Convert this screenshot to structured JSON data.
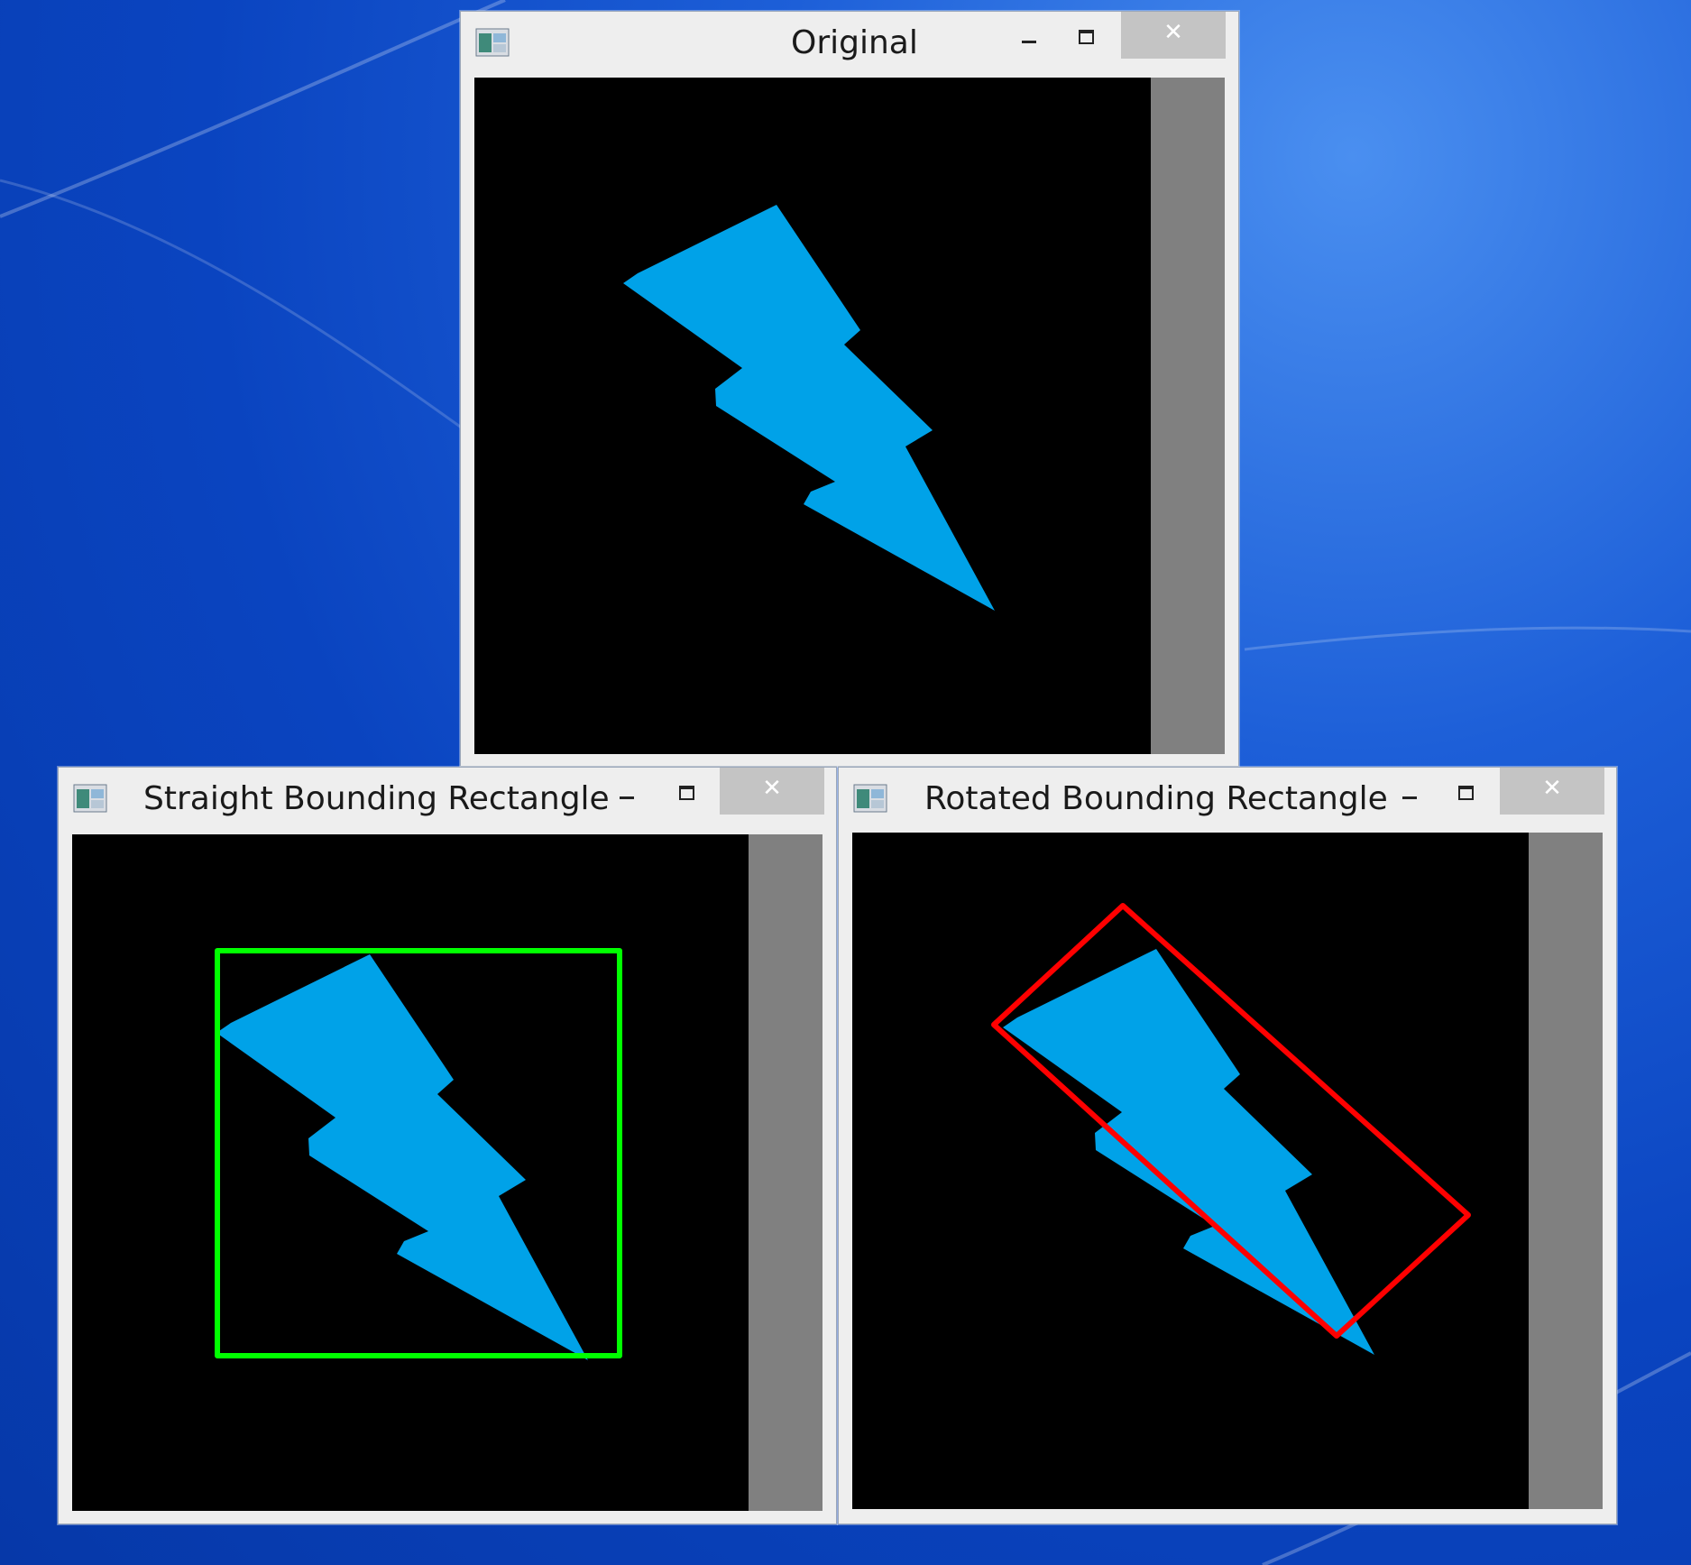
{
  "windows": {
    "original": {
      "title": "Original",
      "minimize_icon": "minimize-icon",
      "maximize_icon": "maximize-icon",
      "close_icon": "close-icon",
      "close_glyph": "✕"
    },
    "straight": {
      "title": "Straight Bounding Rectangle",
      "close_glyph": "✕",
      "rect_color": "#00ff00"
    },
    "rotated": {
      "title": "Rotated Bounding Rectangle",
      "close_glyph": "✕",
      "rect_color": "#ff0000"
    }
  },
  "colors": {
    "shape_fill": "#00a2e8",
    "canvas_bg": "#000000",
    "scroll_strip": "#808080",
    "desktop": "#0a44c0"
  }
}
